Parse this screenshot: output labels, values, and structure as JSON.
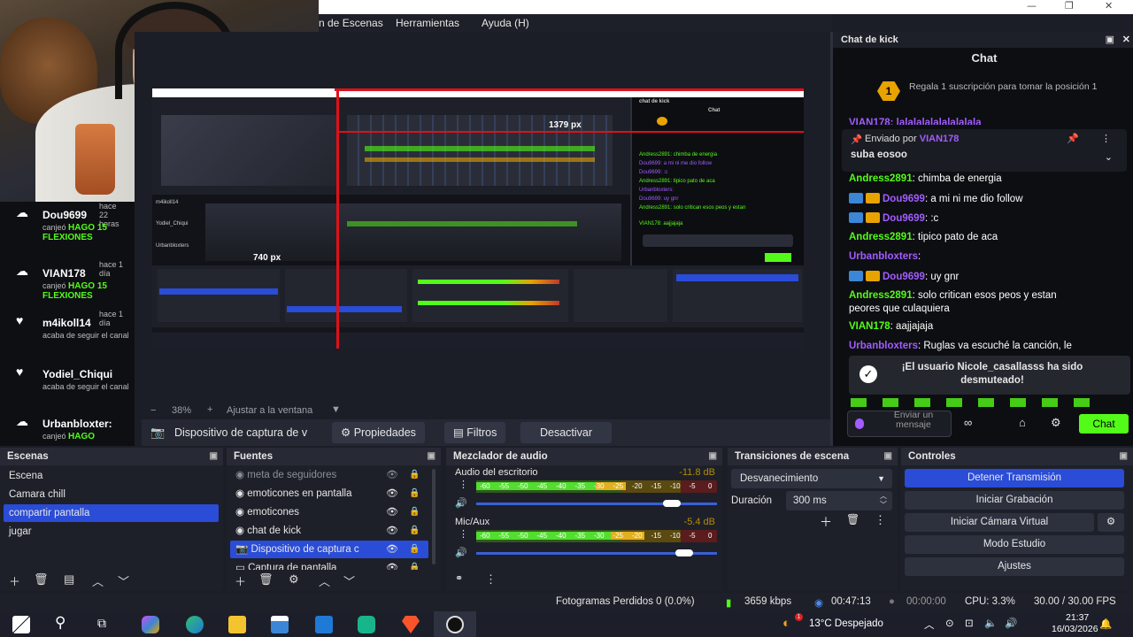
{
  "window": {
    "minimize": "—",
    "maximize": "❐",
    "close": "✕"
  },
  "menu": {
    "items": [
      "n de Escenas",
      "Herramientas",
      "Ayuda (H)"
    ]
  },
  "events": [
    {
      "name": "Dou9699",
      "time": "hace 22 horas",
      "action_prefix": "canjeó",
      "action": "HAGO 15 FLEXIONES",
      "icon": "cloud-icon"
    },
    {
      "name": "VIAN178",
      "time": "hace 1 día",
      "action_prefix": "canjeó",
      "action": "HAGO 15 FLEXIONES",
      "icon": "cloud-icon"
    },
    {
      "name": "m4ikoll14",
      "time": "hace 1 día",
      "action_prefix": "acaba de seguir el canal",
      "action": "",
      "icon": "heart-icon"
    },
    {
      "name": "Yodiel_Chiqui",
      "time": "",
      "action_prefix": "acaba de seguir el canal",
      "action": "",
      "icon": "heart-icon"
    },
    {
      "name": "Urbanbloxter:",
      "time": "",
      "action_prefix": "canjeó",
      "action": "HAGO",
      "icon": "cloud-icon"
    }
  ],
  "preview": {
    "zoom": "38%",
    "zoom_minus": "−",
    "zoom_plus": "+",
    "fit": "Ajustar a la ventana",
    "overlay_top": "1379 px",
    "overlay_left": "740 px"
  },
  "source_bar": {
    "source": "Dispositivo de captura de v",
    "properties": "Propiedades",
    "filters": "Filtros",
    "deactivate": "Desactivar"
  },
  "chat": {
    "dock_title": "Chat de kick",
    "title": "Chat",
    "sub_badge": "1",
    "sub_text": "Regala 1 suscripción para tomar la posición 1",
    "pinned_by": "Enviado por",
    "pinned_user": "VIAN178",
    "pinned_msg": "suba eosoo",
    "cut_line": "VIAN178: lalalalalalalalalala",
    "messages": [
      {
        "user": "Andress2891",
        "text": ": chimba de energia",
        "color": "g",
        "badges": false
      },
      {
        "user": "Dou9699",
        "text": ": a mi ni me dio follow",
        "color": "p",
        "badges": true
      },
      {
        "user": "Dou9699",
        "text": ": :c",
        "color": "p",
        "badges": true
      },
      {
        "user": "Andress2891",
        "text": ": tipico pato de aca",
        "color": "g",
        "badges": false
      },
      {
        "user": "Urbanbloxters",
        "text": ":",
        "color": "p",
        "badges": false
      },
      {
        "user": "Dou9699",
        "text": ": uy gnr",
        "color": "p",
        "badges": true
      },
      {
        "user": "Andress2891",
        "text": ": solo critican esos peos y estan",
        "color": "g",
        "badges": false
      },
      {
        "user": "",
        "text": "peores que culaquiera",
        "color": "w",
        "badges": false
      },
      {
        "user": "VIAN178",
        "text": ": aajjajaja",
        "color": "g",
        "badges": false
      },
      {
        "user": "Urbanbloxters",
        "text": ": Ruglas va escuché la canción, le",
        "color": "p",
        "badges": false
      }
    ],
    "notice": "¡El usuario Nicole_casallasss ha sido desmuteado!",
    "input_placeholder": "Enviar un mensaje",
    "send": "Chat"
  },
  "docks": {
    "scenes": {
      "title": "Escenas",
      "items": [
        "Escena",
        "Camara chill",
        "compartir pantalla",
        "jugar"
      ],
      "selected": 2
    },
    "sources": {
      "title": "Fuentes",
      "items": [
        "meta de seguidores",
        "emoticones en pantalla",
        "emoticones",
        "chat de kick",
        "Dispositivo de captura c",
        "Captura de pantalla"
      ],
      "selected": 4
    },
    "mixer": {
      "title": "Mezclador de audio",
      "channels": [
        {
          "name": "Audio del escritorio",
          "db": "-11.8 dB",
          "level": 0.62,
          "volume": 0.85
        },
        {
          "name": "Mic/Aux",
          "db": "-5.4 dB",
          "level": 0.7,
          "volume": 0.9
        }
      ],
      "ticks": [
        "-60",
        "-55",
        "-50",
        "-45",
        "-40",
        "-35",
        "-30",
        "-25",
        "-20",
        "-15",
        "-10",
        "-5",
        "0"
      ]
    },
    "transitions": {
      "title": "Transiciones de escena",
      "type": "Desvanecimiento",
      "duration_label": "Duración",
      "duration": "300 ms"
    },
    "controls": {
      "title": "Controles",
      "buttons": [
        "Detener Transmisión",
        "Iniciar Grabación",
        "Iniciar Cámara Virtual",
        "Modo Estudio",
        "Ajustes"
      ]
    }
  },
  "status": {
    "dropped": "Fotogramas Perdidos 0 (0.0%)",
    "bitrate": "3659 kbps",
    "stream_time": "00:47:13",
    "rec_time": "00:00:00",
    "cpu": "CPU: 3.3%",
    "fps": "30.00 / 30.00 FPS"
  },
  "taskbar": {
    "weather": "13°C  Despejado",
    "time": "21:37",
    "date": "16/03/2026",
    "notif_badge": "1"
  },
  "colors": {
    "kick_green": "#53fc18",
    "obs_selected": "#2a4cd6",
    "purple_user": "#a25cff"
  }
}
